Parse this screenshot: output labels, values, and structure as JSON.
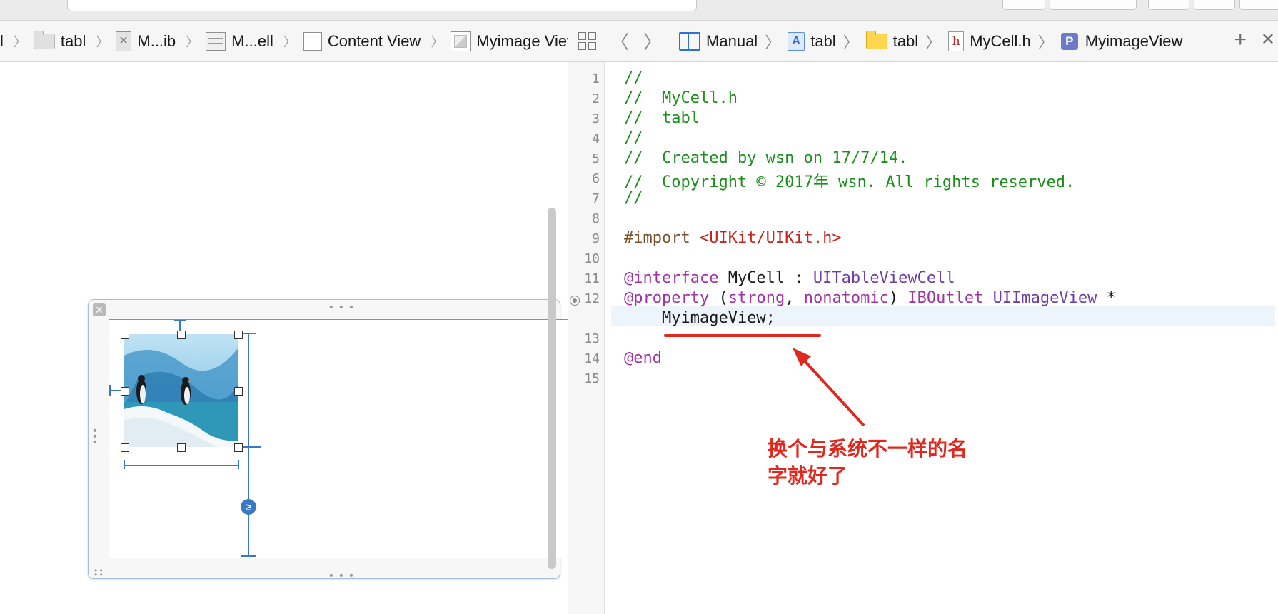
{
  "left_jumpbar": {
    "items": [
      {
        "label": "l"
      },
      {
        "label": "tabl"
      },
      {
        "label": "M...ib"
      },
      {
        "label": "M...ell"
      },
      {
        "label": "Content View"
      },
      {
        "label": "Myimage View"
      }
    ]
  },
  "right_jumpbar": {
    "items": [
      {
        "label": "Manual",
        "icon": "editor-mode-icon"
      },
      {
        "label": "tabl",
        "icon": "app-project-icon"
      },
      {
        "label": "tabl",
        "icon": "folder-icon"
      },
      {
        "label": "MyCell.h",
        "icon": "header-file-icon"
      },
      {
        "label": "MyimageView",
        "icon": "property-icon"
      }
    ],
    "prop_letter": "P",
    "hfile_letter": "h"
  },
  "editor": {
    "line_numbers": [
      "1",
      "2",
      "3",
      "4",
      "5",
      "6",
      "7",
      "8",
      "9",
      "10",
      "11",
      "12",
      "",
      "13",
      "14",
      "15"
    ],
    "breakpoint_line": "12",
    "code": {
      "l1": "//",
      "l2": "//  MyCell.h",
      "l3": "//  tabl",
      "l4": "//",
      "l5": "//  Created by wsn on 17/7/14.",
      "l6": "//  Copyright © 2017年 wsn. All rights reserved.",
      "l7": "//",
      "l9_directive": "#import",
      "l9_path": " <UIKit/UIKit.h>",
      "l11_kw": "@interface",
      "l11_name": " MyCell : ",
      "l11_super": "UITableViewCell",
      "l12_kw": "@property",
      "l12_open": " (",
      "l12_strong": "strong",
      "l12_comma": ", ",
      "l12_nonatomic": "nonatomic",
      "l12_close": ") ",
      "l12_outlet": "IBOutlet",
      "l12_space": " ",
      "l12_type": "UIImageView",
      "l12_star": " *",
      "l12b_name": "    MyimageView;",
      "l14_kw": "@end"
    }
  },
  "annotation": {
    "line1": "换个与系统不一样的名",
    "line2": "字就好了"
  },
  "colors": {
    "comment": "#1a8f1a",
    "keyword": "#a133a6",
    "type": "#6e3fa3",
    "string": "#c0281c",
    "annotation": "#e0281e",
    "constraint": "#3b78c4"
  },
  "canvas": {
    "cell_close_glyph": "✕",
    "gte_glyph": "≥"
  }
}
